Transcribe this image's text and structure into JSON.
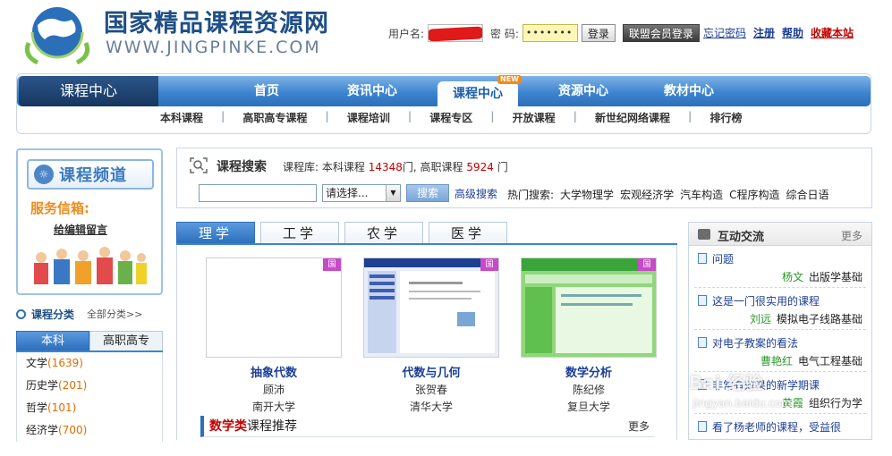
{
  "header": {
    "site_title": "国家精品课程资源网",
    "site_url": "WWW.JINGPINKE.COM",
    "login": {
      "username_label": "用户名:",
      "password_label": "密 码:",
      "password_value": "•••••••",
      "login_button": "登录",
      "union_login_button": "联盟会员登录"
    },
    "links": [
      "忘记密码",
      "注册",
      "帮助",
      "收藏本站"
    ]
  },
  "nav": {
    "home": "课程中心",
    "items": [
      "首页",
      "资讯中心",
      "课程中心",
      "资源中心",
      "教材中心"
    ],
    "active_index": 2,
    "new_badge": "NEW",
    "sub_items": [
      "本科课程",
      "高职高专课程",
      "课程培训",
      "课程专区",
      "开放课程",
      "新世纪网络课程",
      "排行榜"
    ]
  },
  "sidebar": {
    "channel_title": "课程频道",
    "mailbox_title": "服务信箱:",
    "mailbox_link": "给编辑留言",
    "category_title": "课程分类",
    "all_categories": "全部分类>>",
    "tabs": [
      "本科",
      "高职高专"
    ],
    "categories": [
      {
        "name": "文学",
        "count": "(1639)"
      },
      {
        "name": "历史学",
        "count": "(201)"
      },
      {
        "name": "哲学",
        "count": "(101)"
      },
      {
        "name": "经济学",
        "count": "(700)"
      }
    ]
  },
  "search": {
    "title": "课程搜索",
    "stat_prefix": "课程库: 本科课程",
    "undergrad_count": "14348",
    "stat_mid": "门, 高职课程",
    "vocational_count": "5924",
    "stat_suffix": "门",
    "select_value": "请选择...",
    "button": "搜索",
    "advanced": "高级搜索",
    "hot_label": "热门搜索:",
    "hot_terms": [
      "大学物理学",
      "宏观经济学",
      "汽车构造",
      "C程序构造",
      "综合日语"
    ]
  },
  "subject_tabs": [
    "理学",
    "工学",
    "农学",
    "医学"
  ],
  "courses": [
    {
      "title": "抽象代数",
      "teacher": "顾沛",
      "school": "南开大学",
      "badge": "国"
    },
    {
      "title": "代数与几何",
      "teacher": "张贺春",
      "school": "清华大学",
      "badge": "国"
    },
    {
      "title": "数学分析",
      "teacher": "陈纪修",
      "school": "复旦大学",
      "badge": "国"
    }
  ],
  "recommend": {
    "keyword": "数学类",
    "rest": "课程推荐",
    "more": "更多"
  },
  "interaction": {
    "title": "互动交流",
    "more": "更多",
    "items": [
      {
        "question": "问题",
        "name": "杨文",
        "course": "出版学基础"
      },
      {
        "question": "这是一门很实用的课程",
        "name": "刘远",
        "course": "模拟电子线路基础"
      },
      {
        "question": "对电子教案的看法",
        "name": "曹艳红",
        "course": "电气工程基础"
      },
      {
        "question": "非常有效果的新学期课",
        "name": "黄霞",
        "course": "组织行为学"
      },
      {
        "question": "看了杨老师的课程，受益很",
        "name": "",
        "course": ""
      }
    ]
  },
  "watermark": {
    "text": "Bai 经验",
    "url": "jingyan.baidu.com"
  }
}
